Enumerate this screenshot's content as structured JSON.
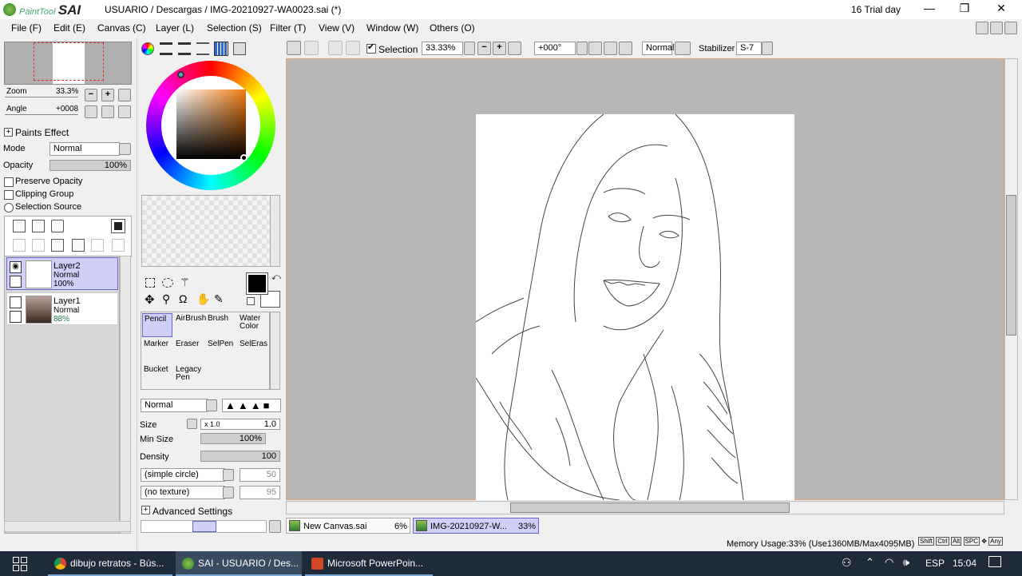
{
  "window": {
    "app_logo": "PaintTool SAI",
    "title": "USUARIO / Descargas / IMG-20210927-WA0023.sai (*)",
    "trial": "16 Trial day",
    "minimize": "—",
    "maximize": "❐",
    "close": "✕"
  },
  "menu": [
    "File (F)",
    "Edit (E)",
    "Canvas (C)",
    "Layer (L)",
    "Selection (S)",
    "Filter (T)",
    "View (V)",
    "Window (W)",
    "Others (O)"
  ],
  "toolbar": {
    "selection_label": "Selection",
    "zoom": "33.33%",
    "angle": "+000°",
    "blend": "Normal",
    "stabilizer_label": "Stabilizer",
    "stabilizer": "S-7"
  },
  "navigator": {
    "zoom_label": "Zoom",
    "zoom_value": "33.3%",
    "angle_label": "Angle",
    "angle_value": "+0008"
  },
  "layer_panel": {
    "paints_effect": "Paints Effect",
    "mode_label": "Mode",
    "mode_value": "Normal",
    "opacity_label": "Opacity",
    "opacity_value": "100%",
    "opacity_level": 1.0,
    "preserve_opacity": "Preserve Opacity",
    "clipping_group": "Clipping Group",
    "selection_source": "Selection Source",
    "layers": [
      {
        "name": "Layer2",
        "mode": "Normal",
        "opacity": "100%",
        "selected": true
      },
      {
        "name": "Layer1",
        "mode": "Normal",
        "opacity": "88%",
        "selected": false
      }
    ]
  },
  "color": {
    "current": "#000000",
    "secondary": "#ffffff",
    "hue_color": "#f07a10"
  },
  "tools": [
    {
      "label": "Pencil",
      "selected": true
    },
    {
      "label": "AirBrush"
    },
    {
      "label": "Brush"
    },
    {
      "label": "Water Color"
    },
    {
      "label": "Marker"
    },
    {
      "label": "Eraser"
    },
    {
      "label": "SelPen"
    },
    {
      "label": "SelEras"
    },
    {
      "label": "Bucket"
    },
    {
      "label": "Legacy Pen"
    }
  ],
  "brush": {
    "blend": "Normal",
    "size_label": "Size",
    "size_mult": "x 1.0",
    "size_value": "1.0",
    "minsize_label": "Min Size",
    "minsize_value": "100%",
    "density_label": "Density",
    "density_value": "100",
    "shape": "(simple circle)",
    "shape_value": "50",
    "texture": "(no texture)",
    "texture_value": "95",
    "advanced": "Advanced Settings"
  },
  "tabs": [
    {
      "name": "New Canvas.sai",
      "zoom": "6%"
    },
    {
      "name": "IMG-20210927-W...",
      "zoom": "33%",
      "active": true
    }
  ],
  "status": {
    "memory": "Memory Usage:33% (Use1360MB/Max4095MB)",
    "keys": [
      "Shift",
      "Ctrl",
      "Alt",
      "SPC",
      "Any"
    ]
  },
  "taskbar": {
    "items": [
      "dibujo retratos - Bús...",
      "SAI - USUARIO / Des...",
      "Microsoft PowerPoin..."
    ],
    "lang": "ESP",
    "time": "15:04"
  }
}
